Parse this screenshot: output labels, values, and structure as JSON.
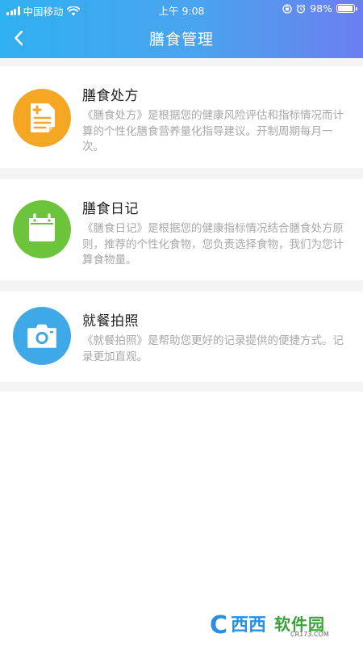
{
  "status_bar": {
    "carrier": "中国移动",
    "time": "上午 9:08",
    "battery": "98%",
    "battery_level": 0.98
  },
  "nav": {
    "title": "膳食管理",
    "back_icon": "chevron-left-icon"
  },
  "cards": [
    {
      "title": "膳食处方",
      "description": "《膳食处方》是根据您的健康风险评估和指标情况而计算的个性化膳食营养量化指导建议。开制周期每月一次。",
      "icon": "prescription-document-icon",
      "color": "#f5a623"
    },
    {
      "title": "膳食日记",
      "description": "《膳食日记》是根据您的健康指标情况结合膳食处方原则，推荐的个性化食物，您负责选择食物，我们为您计算食物量。",
      "icon": "calendar-icon",
      "color": "#6cc43a"
    },
    {
      "title": "就餐拍照",
      "description": "《就餐拍照》是帮助您更好的记录提供的便捷方式。记录更加直观。",
      "icon": "camera-icon",
      "color": "#3fa9e8"
    }
  ],
  "watermark": {
    "brand": "西西软件园",
    "url": "CR173.COM",
    "brand_main": "西西",
    "brand_sub": "软件园"
  }
}
